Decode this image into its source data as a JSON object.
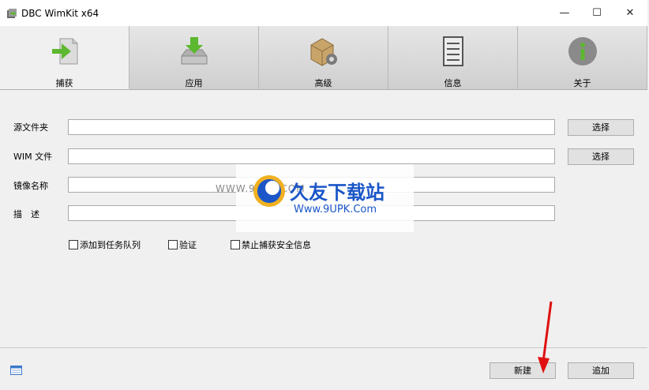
{
  "window": {
    "title": "DBC WimKit x64",
    "minimize": "—",
    "maximize": "☐",
    "close": "✕"
  },
  "tabs": [
    {
      "label": "捕获",
      "icon": "capture-icon",
      "active": true
    },
    {
      "label": "应用",
      "icon": "apply-icon",
      "active": false
    },
    {
      "label": "高级",
      "icon": "advanced-icon",
      "active": false
    },
    {
      "label": "信息",
      "icon": "info-document-icon",
      "active": false
    },
    {
      "label": "关于",
      "icon": "about-icon",
      "active": false
    }
  ],
  "form": {
    "source_folder_label": "源文件夹",
    "source_folder_value": "",
    "wim_file_label": "WIM 文件",
    "wim_file_value": "",
    "image_name_label": "镜像名称",
    "image_name_value": "",
    "description_label": "描　述",
    "description_value": "",
    "browse_label": "选择"
  },
  "options": [
    {
      "label": "添加到任务队列",
      "checked": false
    },
    {
      "label": "验证",
      "checked": false
    },
    {
      "label": "禁止捕获安全信息",
      "checked": false
    }
  ],
  "footer": {
    "new_label": "新建",
    "add_label": "追加"
  },
  "watermark": {
    "side_text": "WWW.9UPK.COM",
    "brand": "久友下载站",
    "url": "Www.9UPK.Com"
  },
  "colors": {
    "accent_green": "#5cb82f",
    "arrow_red": "#e01010",
    "watermark_blue": "#1a56c8"
  }
}
